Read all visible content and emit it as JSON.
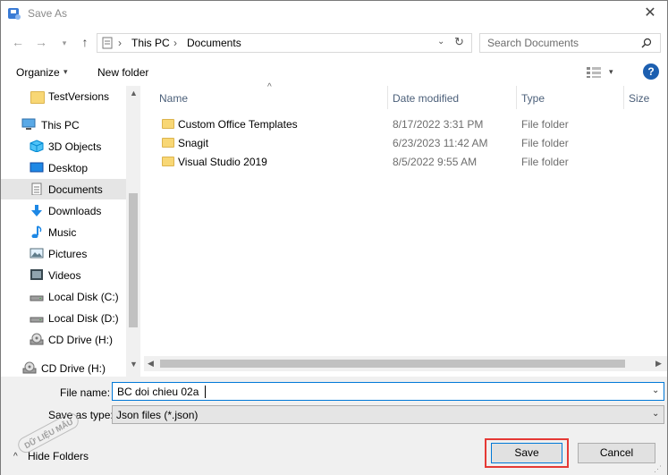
{
  "window": {
    "title": "Save As"
  },
  "address": {
    "segments": [
      "This PC",
      "Documents"
    ]
  },
  "search": {
    "placeholder": "Search Documents"
  },
  "toolbar": {
    "organize": "Organize",
    "new_folder": "New folder"
  },
  "nav": {
    "items": [
      {
        "label": "TestVersions",
        "icon": "folder-icon"
      },
      {
        "label": "This PC",
        "icon": "computer-icon"
      },
      {
        "label": "3D Objects",
        "icon": "cube-icon"
      },
      {
        "label": "Desktop",
        "icon": "desktop-icon"
      },
      {
        "label": "Documents",
        "icon": "document-icon",
        "selected": true
      },
      {
        "label": "Downloads",
        "icon": "download-icon"
      },
      {
        "label": "Music",
        "icon": "music-icon"
      },
      {
        "label": "Pictures",
        "icon": "pictures-icon"
      },
      {
        "label": "Videos",
        "icon": "video-icon"
      },
      {
        "label": "Local Disk (C:)",
        "icon": "disk-icon"
      },
      {
        "label": "Local Disk (D:)",
        "icon": "disk-icon"
      },
      {
        "label": "CD Drive (H:)",
        "icon": "cd-icon"
      },
      {
        "label": "CD Drive (H:)",
        "icon": "cd-icon"
      }
    ]
  },
  "columns": {
    "name": "Name",
    "date": "Date modified",
    "type": "Type",
    "size": "Size"
  },
  "files": [
    {
      "name": "Custom Office Templates",
      "date": "8/17/2022 3:31 PM",
      "type": "File folder"
    },
    {
      "name": "Snagit",
      "date": "6/23/2023 11:42 AM",
      "type": "File folder"
    },
    {
      "name": "Visual Studio 2019",
      "date": "8/5/2022 9:55 AM",
      "type": "File folder"
    }
  ],
  "form": {
    "file_name_label": "File name:",
    "file_name_value": "BC doi chieu 02a",
    "save_type_label": "Save as type:",
    "save_type_value": "Json files (*.json)"
  },
  "footer": {
    "hide_folders": "Hide Folders",
    "save": "Save",
    "cancel": "Cancel",
    "watermark": "DỮ LIỆU MẪU"
  },
  "colors": {
    "accent": "#0078d7",
    "highlight": "#e53935",
    "folder": "#f8d775"
  }
}
